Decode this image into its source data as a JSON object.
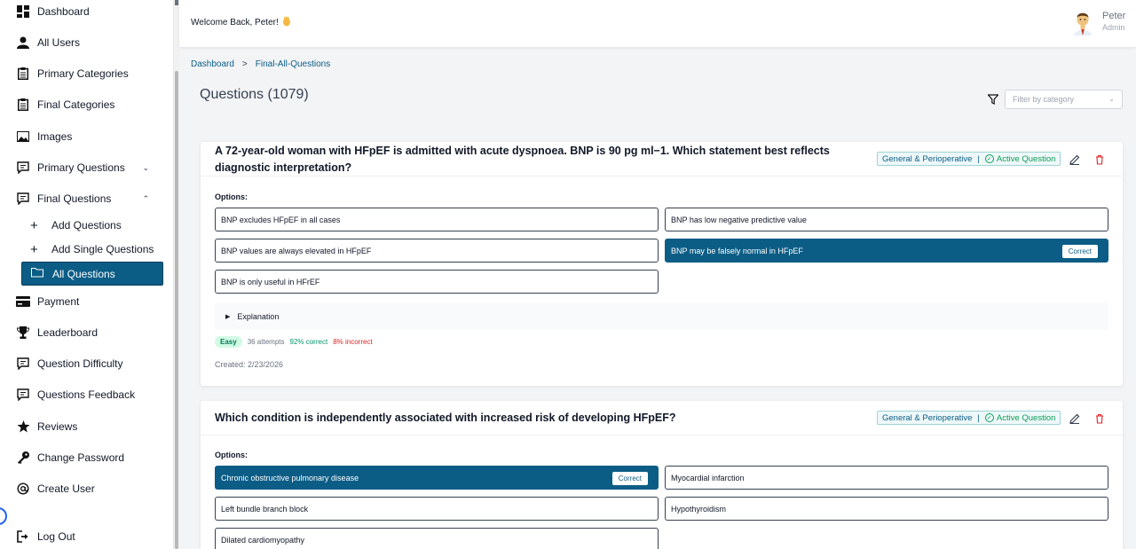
{
  "colors": {
    "accent": "#0b5d86",
    "success": "#0f9d58",
    "danger": "#dc2626"
  },
  "sidebar": {
    "items": [
      {
        "label": "Dashboard",
        "icon": "dashboard-icon"
      },
      {
        "label": "All Users",
        "icon": "user-icon"
      },
      {
        "label": "Primary Categories",
        "icon": "clipboard-icon"
      },
      {
        "label": "Final Categories",
        "icon": "clipboard-icon"
      },
      {
        "label": "Images",
        "icon": "image-icon"
      },
      {
        "label": "Primary Questions",
        "icon": "chat-icon"
      },
      {
        "label": "Final Questions",
        "icon": "chat-icon"
      },
      {
        "label": "Payment",
        "icon": "card-icon"
      },
      {
        "label": "Leaderboard",
        "icon": "trophy-icon"
      },
      {
        "label": "Question Difficulty",
        "icon": "chat-icon"
      },
      {
        "label": "Questions Feedback",
        "icon": "chat-icon"
      },
      {
        "label": "Reviews",
        "icon": "star-icon"
      },
      {
        "label": "Change Password",
        "icon": "key-icon"
      },
      {
        "label": "Create User",
        "icon": "at-icon"
      },
      {
        "label": "Log Out",
        "icon": "logout-icon"
      }
    ],
    "subitems": [
      {
        "label": "Add Questions",
        "icon": "plus-icon"
      },
      {
        "label": "Add Single Questions",
        "icon": "plus-icon"
      },
      {
        "label": "All Questions",
        "icon": "folder-icon"
      }
    ]
  },
  "header": {
    "welcome": "Welcome Back, Peter!",
    "wave_icon": "wave-hand-icon",
    "user_name": "Peter",
    "user_role": "Admin"
  },
  "breadcrumb": {
    "root": "Dashboard",
    "current": "Final-All-Questions"
  },
  "page": {
    "title": "Questions (1079)",
    "filter_placeholder": "Filter by category"
  },
  "questions": [
    {
      "text": "A 72-year-old woman with HFpEF is admitted with acute dyspnoea. BNP is 90 pg ml−1. Which statement best reflects diagnostic interpretation?",
      "category": "General & Perioperative",
      "status": "Active Question",
      "options_label": "Options:",
      "options": [
        "BNP excludes HFpEF in all cases",
        "BNP has low negative predictive value",
        "BNP values are always elevated in HFpEF",
        "BNP may be falsely normal in HFpEF",
        "BNP is only useful in HFrEF"
      ],
      "correct_label": "Correct",
      "explanation_label": "Explanation",
      "difficulty": "Easy",
      "attempts": "36 attempts",
      "correct_pct": "92% correct",
      "incorrect_pct": "8% incorrect",
      "created": "Created: 2/23/2026"
    },
    {
      "text": "Which condition is independently associated with increased risk of developing HFpEF?",
      "category": "General & Perioperative",
      "status": "Active Question",
      "options_label": "Options:",
      "options": [
        "Chronic obstructive pulmonary disease",
        "Myocardial infarction",
        "Left bundle branch block",
        "Hypothyroidism",
        "Dilated cardiomyopathy"
      ],
      "correct_label": "Correct"
    }
  ]
}
